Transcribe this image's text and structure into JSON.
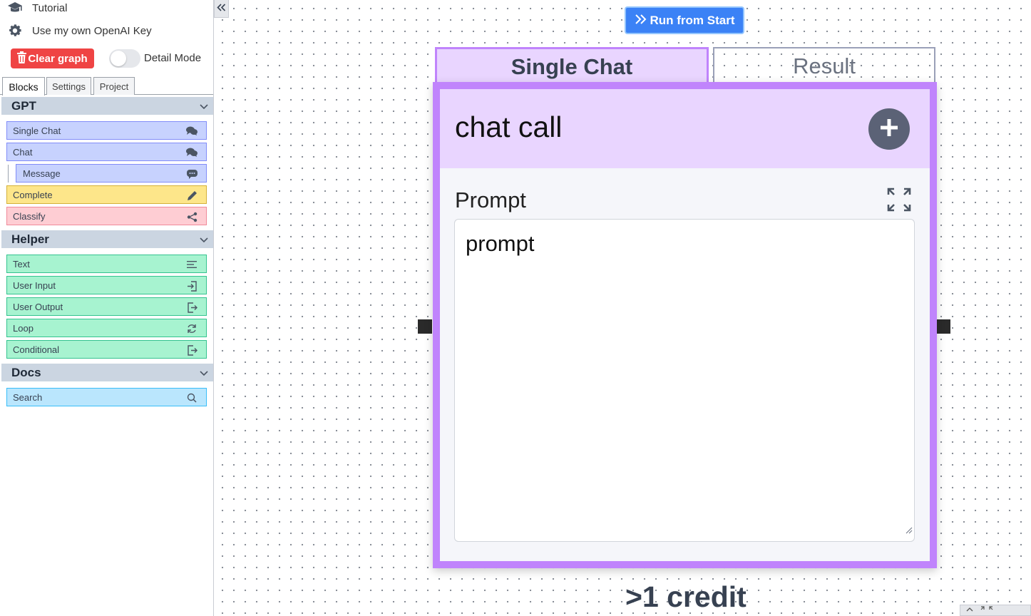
{
  "sidebar": {
    "tutorial_label": "Tutorial",
    "openai_key_label": "Use my own OpenAI Key",
    "clear_graph_label": "Clear graph",
    "detail_mode_label": "Detail Mode",
    "detail_mode_on": false,
    "tabs": [
      {
        "label": "Blocks",
        "active": true
      },
      {
        "label": "Settings",
        "active": false
      },
      {
        "label": "Project",
        "active": false
      }
    ],
    "sections": [
      {
        "title": "GPT",
        "items": [
          {
            "label": "Single Chat",
            "icon": "chat-bubbles-icon",
            "color": "#c7d2fe"
          },
          {
            "label": "Chat",
            "icon": "chat-bubbles-icon",
            "color": "#c7d2fe"
          },
          {
            "label": "Message",
            "icon": "chat-bubble-icon",
            "color": "#c7d2fe"
          },
          {
            "label": "Complete",
            "icon": "pencil-icon",
            "color": "#fde68a"
          },
          {
            "label": "Classify",
            "icon": "share-icon",
            "color": "#fecdd3"
          }
        ]
      },
      {
        "title": "Helper",
        "items": [
          {
            "label": "Text",
            "icon": "text-lines-icon",
            "color": "#a7f3d0"
          },
          {
            "label": "User Input",
            "icon": "input-icon",
            "color": "#a7f3d0"
          },
          {
            "label": "User Output",
            "icon": "output-icon",
            "color": "#a7f3d0"
          },
          {
            "label": "Loop",
            "icon": "refresh-icon",
            "color": "#a7f3d0"
          },
          {
            "label": "Conditional",
            "icon": "output-icon",
            "color": "#a7f3d0"
          }
        ]
      },
      {
        "title": "Docs",
        "items": [
          {
            "label": "Search",
            "icon": "search-icon",
            "color": "#bae6fd"
          }
        ]
      }
    ]
  },
  "canvas": {
    "run_button_label": "Run from Start",
    "node": {
      "tabs": [
        "Single Chat",
        "Result"
      ],
      "title": "chat call",
      "prompt_label": "Prompt",
      "prompt_value": "prompt",
      "accent_color": "#c084fc"
    },
    "credit_label": ">1 credit"
  }
}
